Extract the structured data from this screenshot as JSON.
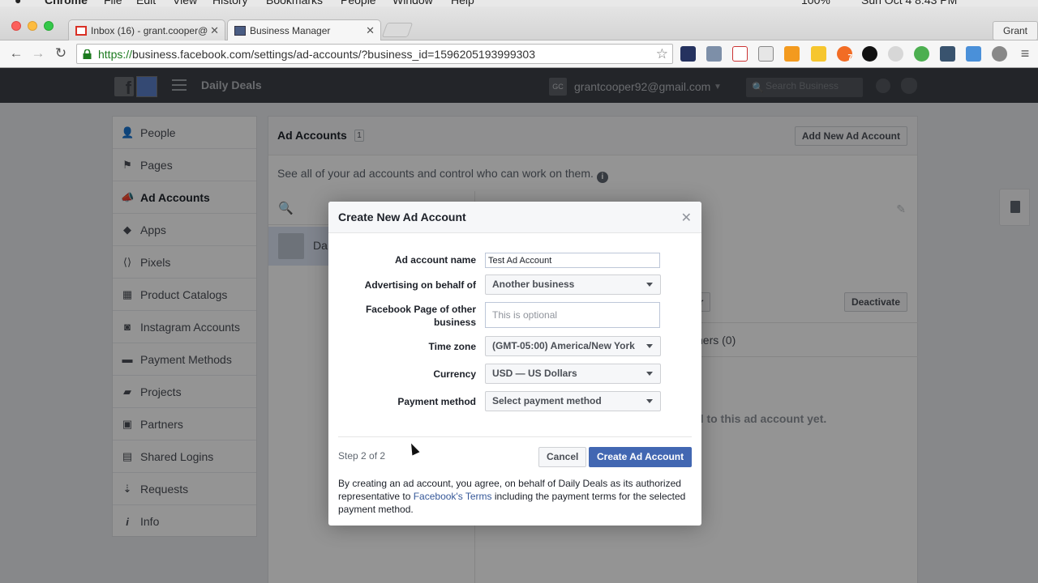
{
  "os_menu": {
    "items": [
      "Chrome",
      "File",
      "Edit",
      "View",
      "History",
      "Bookmarks",
      "People",
      "Window",
      "Help"
    ],
    "battery": "100%",
    "clock": "Sun Oct 4  8:43 PM"
  },
  "browser": {
    "tabs": [
      {
        "label": "Inbox (16) - grant.cooper@",
        "active": false
      },
      {
        "label": "Business Manager",
        "active": true
      }
    ],
    "profile_name": "Grant",
    "url_scheme": "https://",
    "url_rest": "business.facebook.com/settings/ad-accounts/?business_id=1596205193999303",
    "extension_badge_count": "7"
  },
  "topbar": {
    "business_name": "Daily Deals",
    "account_initials": "GC",
    "account_email": "grantcooper92@gmail.com",
    "search_placeholder": "Search Business",
    "logo_letter": "f"
  },
  "sidebar": {
    "items": [
      {
        "label": "People",
        "icon": "person-icon",
        "active": false
      },
      {
        "label": "Pages",
        "icon": "flag-icon",
        "active": false
      },
      {
        "label": "Ad Accounts",
        "icon": "megaphone-icon",
        "active": true
      },
      {
        "label": "Apps",
        "icon": "cube-icon",
        "active": false
      },
      {
        "label": "Pixels",
        "icon": "code-icon",
        "active": false
      },
      {
        "label": "Product Catalogs",
        "icon": "grid-icon",
        "active": false
      },
      {
        "label": "Instagram Accounts",
        "icon": "camera-icon",
        "active": false
      },
      {
        "label": "Payment Methods",
        "icon": "card-icon",
        "active": false
      },
      {
        "label": "Projects",
        "icon": "folder-icon",
        "active": false
      },
      {
        "label": "Partners",
        "icon": "briefcase-icon",
        "active": false
      },
      {
        "label": "Shared Logins",
        "icon": "id-card-icon",
        "active": false
      },
      {
        "label": "Requests",
        "icon": "request-icon",
        "active": false
      },
      {
        "label": "Info",
        "icon": "info-icon",
        "active": false
      }
    ]
  },
  "main": {
    "title": "Ad Accounts",
    "count": "1",
    "add_button": "Add New Ad Account",
    "description": "See all of your ad accounts and control who can work on them.",
    "list_item_name": "Da",
    "assign_button": "er",
    "deactivate_button": "Deactivate",
    "partners_tab": "ners  (0)",
    "empty_message": "d to this ad account yet."
  },
  "modal": {
    "title": "Create New Ad Account",
    "fields": {
      "ad_account_name": {
        "label": "Ad account name",
        "value": "Test Ad Account"
      },
      "behalf_of": {
        "label": "Advertising on behalf of",
        "value": "Another business"
      },
      "page_of_business": {
        "label": "Facebook Page of other business",
        "placeholder": "This is optional"
      },
      "time_zone": {
        "label": "Time zone",
        "value": "(GMT-05:00) America/New York"
      },
      "currency": {
        "label": "Currency",
        "value": "USD — US Dollars"
      },
      "payment_method": {
        "label": "Payment method",
        "value": "Select payment method"
      }
    },
    "step": "Step 2 of 2",
    "cancel_button": "Cancel",
    "create_button": "Create Ad Account",
    "legal_prefix": "By creating an ad account, you agree, on behalf of Daily Deals as its authorized representative to ",
    "legal_link": "Facebook's Terms",
    "legal_suffix": " including the payment terms for the selected payment method."
  },
  "colors": {
    "fb_blue": "#4267b2",
    "link_blue": "#365899",
    "bluebar_dark": "#3d4047",
    "page_bg": "#e9ebee"
  }
}
